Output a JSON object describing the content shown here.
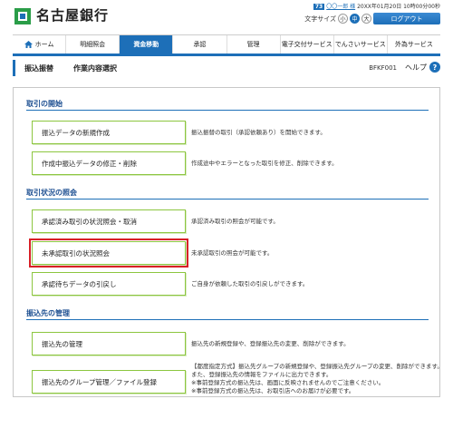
{
  "header": {
    "logo_text": "名古屋銀行",
    "user_tag": "73",
    "user_name": "〇〇一郎 様",
    "login_time": "20XX年01月20日 10時00分00秒",
    "font_size_label": "文字サイズ",
    "font_sizes": [
      "小",
      "中",
      "大"
    ],
    "logout_label": "ログアウト"
  },
  "nav": {
    "items": [
      "ホーム",
      "明細照会",
      "資金移動",
      "承認",
      "管理",
      "電子交付サービス",
      "でんさいサービス",
      "外為サービス"
    ],
    "active": "資金移動"
  },
  "title": {
    "crumb_main": "振込振替",
    "crumb_sub": "作業内容選択",
    "screen_id": "BFKF001",
    "help_label": "ヘルプ",
    "help_icon": "?"
  },
  "sections": {
    "s1": {
      "title": "取引の開始",
      "b1": {
        "label": "振込データの新規作成",
        "desc": "振込振替の取引（承認依頼あり）を開始できます。"
      },
      "b2": {
        "label": "作成中振込データの修正・削除",
        "desc": "作成途中やエラーとなった取引を修正、削除できます。"
      }
    },
    "s2": {
      "title": "取引状況の照会",
      "b1": {
        "label": "承認済み取引の状況照会・取消",
        "desc": "承認済み取引の照会が可能です。"
      },
      "b2": {
        "label": "未承認取引の状況照会",
        "desc": "未承認取引の照会が可能です。"
      },
      "b3": {
        "label": "承認待ちデータの引戻し",
        "desc": "ご自身が依頼した取引の引戻しができます。"
      }
    },
    "s3": {
      "title": "振込先の管理",
      "b1": {
        "label": "振込先の管理",
        "desc": "振込先の新規登録や、登録振込先の変更、削除ができます。"
      },
      "b2": {
        "label": "振込先のグループ管理／ファイル登録",
        "desc_line1": "【都度指定方式】振込先グループの新規登録や、登録振込先グループの変更、削除ができます。",
        "desc_line2": "また、登録振込先の情報をファイルに出力できます。",
        "desc_line3": "※事前登録方式の振込先は、画面に反映されませんのでご注意ください。",
        "desc_line4": "※事前登録方式の振込先は、お取引店へのお届けが必要です。"
      }
    }
  },
  "colors": {
    "brand_blue": "#1d6fb8",
    "button_border": "#8cc63f",
    "highlight_red": "#d81f26"
  }
}
